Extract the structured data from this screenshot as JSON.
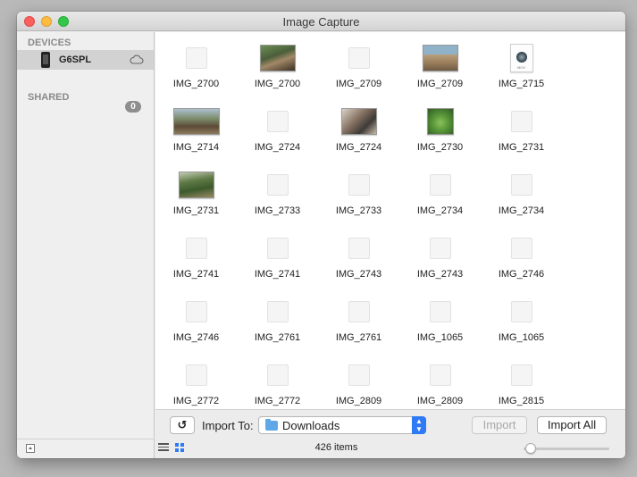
{
  "window": {
    "title": "Image Capture"
  },
  "sidebar": {
    "devices_header": "DEVICES",
    "device": {
      "name": "G6SPL",
      "icon": "iphone-icon",
      "eject_icon": "cloud-eject-icon"
    },
    "shared_header": "SHARED",
    "shared_count": "0"
  },
  "thumbnails": [
    {
      "label": "IMG_2700",
      "kind": "placeholder"
    },
    {
      "label": "IMG_2700",
      "kind": "photo",
      "style": "p1"
    },
    {
      "label": "IMG_2709",
      "kind": "placeholder"
    },
    {
      "label": "IMG_2709",
      "kind": "photo",
      "style": "p2"
    },
    {
      "label": "IMG_2715",
      "kind": "movie"
    },
    {
      "label": "IMG_2714",
      "kind": "photo-wide",
      "style": "p3"
    },
    {
      "label": "IMG_2724",
      "kind": "placeholder"
    },
    {
      "label": "IMG_2724",
      "kind": "photo",
      "style": "p4"
    },
    {
      "label": "IMG_2730",
      "kind": "photo-small",
      "style": "p5"
    },
    {
      "label": "IMG_2731",
      "kind": "placeholder"
    },
    {
      "label": "IMG_2731",
      "kind": "photo",
      "style": "p6"
    },
    {
      "label": "IMG_2733",
      "kind": "placeholder"
    },
    {
      "label": "IMG_2733",
      "kind": "placeholder"
    },
    {
      "label": "IMG_2734",
      "kind": "placeholder"
    },
    {
      "label": "IMG_2734",
      "kind": "placeholder"
    },
    {
      "label": "IMG_2741",
      "kind": "placeholder"
    },
    {
      "label": "IMG_2741",
      "kind": "placeholder"
    },
    {
      "label": "IMG_2743",
      "kind": "placeholder"
    },
    {
      "label": "IMG_2743",
      "kind": "placeholder"
    },
    {
      "label": "IMG_2746",
      "kind": "placeholder"
    },
    {
      "label": "IMG_2746",
      "kind": "placeholder"
    },
    {
      "label": "IMG_2761",
      "kind": "placeholder"
    },
    {
      "label": "IMG_2761",
      "kind": "placeholder"
    },
    {
      "label": "IMG_1065",
      "kind": "placeholder"
    },
    {
      "label": "IMG_1065",
      "kind": "placeholder"
    },
    {
      "label": "IMG_2772",
      "kind": "placeholder"
    },
    {
      "label": "IMG_2772",
      "kind": "placeholder"
    },
    {
      "label": "IMG_2809",
      "kind": "placeholder"
    },
    {
      "label": "IMG_2809",
      "kind": "placeholder"
    },
    {
      "label": "IMG_2815",
      "kind": "placeholder"
    }
  ],
  "toolbar": {
    "rotate_label": "↺",
    "import_to_label": "Import To:",
    "destination": "Downloads",
    "destination_icon": "folder-icon",
    "import_label": "Import",
    "import_all_label": "Import All",
    "item_count": "426 items",
    "thumbnail_size": 0.02
  },
  "colors": {
    "accent": "#2f7bf5",
    "selected_row": "#d2d2d2"
  }
}
